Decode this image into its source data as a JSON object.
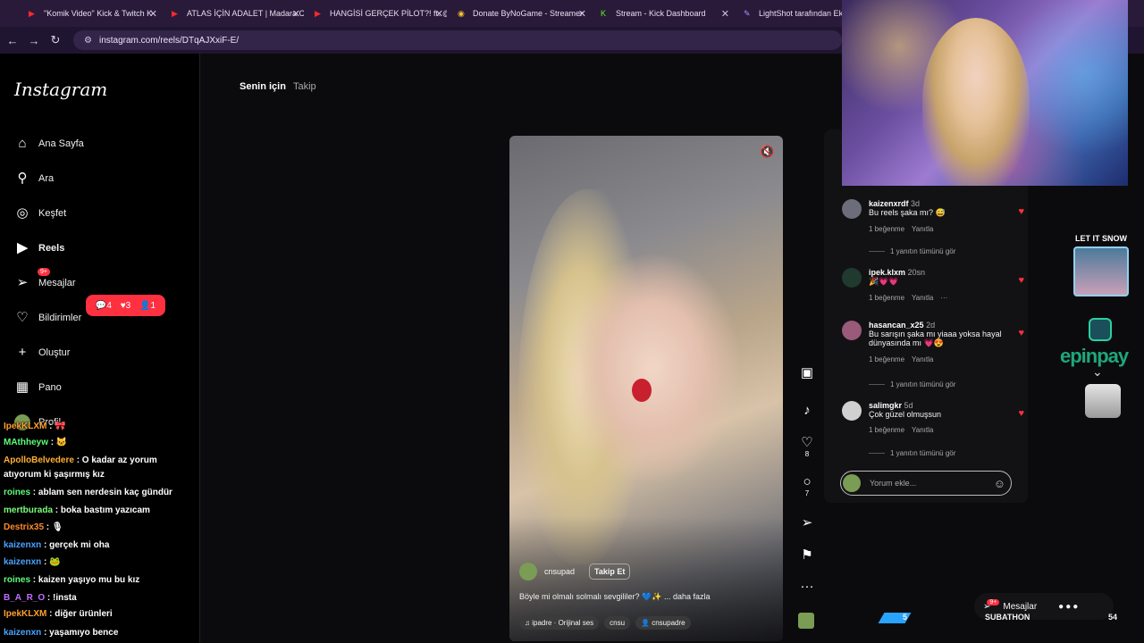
{
  "browser": {
    "tabs": [
      {
        "title": "\"Komik Video\" Kick & Twitch K",
        "color": "#ff2a2a",
        "glyph": "▶"
      },
      {
        "title": "ATLAS İÇİN ADALET | Madara C",
        "color": "#ff2a2a",
        "glyph": "▶"
      },
      {
        "title": "HANGİSİ GERÇEK PİLOT?! ft. @",
        "color": "#ff2a2a",
        "glyph": "▶"
      },
      {
        "title": "Donate ByNoGame - Streamer",
        "color": "#f2c230",
        "glyph": "◉"
      },
      {
        "title": "Stream - Kick Dashboard",
        "color": "#53fc18",
        "glyph": "K"
      },
      {
        "title": "LightShot tarafından Ekran Gö",
        "color": "#b38bff",
        "glyph": "✎"
      }
    ],
    "url": "instagram.com/reels/DTqAJXxiF-E/"
  },
  "sidebar": {
    "logo": "Instagram",
    "items": [
      {
        "label": "Ana Sayfa",
        "icon": "home-icon",
        "glyph": "⌂"
      },
      {
        "label": "Ara",
        "icon": "search-icon",
        "glyph": "⚲"
      },
      {
        "label": "Keşfet",
        "icon": "compass-icon",
        "glyph": "◎"
      },
      {
        "label": "Reels",
        "icon": "reels-icon",
        "glyph": "▶"
      },
      {
        "label": "Mesajlar",
        "icon": "messages-icon",
        "glyph": "➢"
      },
      {
        "label": "Bildirimler",
        "icon": "heart-icon",
        "glyph": "♡"
      },
      {
        "label": "Oluştur",
        "icon": "plus-icon",
        "glyph": "+"
      },
      {
        "label": "Pano",
        "icon": "dashboard-icon",
        "glyph": "▦"
      },
      {
        "label": "Profil",
        "icon": "profile-avatar-icon",
        "glyph": ""
      }
    ],
    "messages_badge": "9+",
    "notifications": {
      "comments": "4",
      "likes": "3",
      "follows": "1"
    }
  },
  "feed_tabs": {
    "active": "Senin için",
    "other": "Takip"
  },
  "reel": {
    "author": "cnsupad",
    "follow_label": "Takip Et",
    "caption": "Böyle mi olmalı solmalı sevgililer? 💙✨ ... daha fazla",
    "audio": "♫ ipadre · Orijinal ses",
    "tag1": "cnsu",
    "tag2": "👤 cnsupadre",
    "likes": "8",
    "comments": "7"
  },
  "comments": [
    {
      "user": "kaizenxrdf",
      "time": "3d",
      "text": "Bu reels şaka mı? 😅",
      "likes": "1 beğenme",
      "reply": "Yanıtla",
      "replies": "1 yanıtın tümünü gör",
      "avatar": "#6c6c7a"
    },
    {
      "user": "ipek.klxm",
      "time": "20sn",
      "text": "🎉💗💗",
      "likes": "1 beğenme",
      "reply": "Yanıtla",
      "more": "···",
      "replies": "",
      "avatar": "#203a30"
    },
    {
      "user": "hasancan_x25",
      "time": "2d",
      "text": "Bu sarışın şaka mı yiaaa yoksa hayal dünyasında mı 💗😍",
      "likes": "1 beğenme",
      "reply": "Yanıtla",
      "replies": "1 yanıtın tümünü gör",
      "avatar": "#9a5a7a"
    },
    {
      "user": "salimgkr",
      "time": "5d",
      "text": "Çok güzel olmuşsun",
      "likes": "1 beğenme",
      "reply": "Yanıtla",
      "replies": "1 yanıtın tümünü gör",
      "avatar": "#d0d0d0"
    }
  ],
  "comment_input": {
    "placeholder": "Yorum ekle..."
  },
  "overlays": {
    "snow_title": "LET IT SNOW",
    "epin": "epinpay"
  },
  "chat": [
    {
      "user": "IpekKLXM",
      "color": "#ff9f2f",
      "text": " : 🎀"
    },
    {
      "user": "MAthheyw",
      "color": "#5cff7a",
      "text": " : 🐱"
    },
    {
      "user": "ApolloBelvedere",
      "color": "#ffb030",
      "text": " : O kadar az yorum"
    },
    {
      "user": "",
      "color": "#fff",
      "text": "atıyorum ki şaşırmış kız"
    },
    {
      "user": "roines",
      "color": "#5cff7a",
      "text": " : ablam sen nerdesin kaç gündür"
    },
    {
      "user": "mertburada",
      "color": "#7aff7a",
      "text": " : boka bastım yazıcam"
    },
    {
      "user": "Destrix35",
      "color": "#ff8a2a",
      "text": " : 🎙"
    },
    {
      "user": "kaizenxn",
      "color": "#4aa3ff",
      "text": " : gerçek mi oha"
    },
    {
      "user": "kaizenxn",
      "color": "#4aa3ff",
      "text": " : 🐸"
    },
    {
      "user": "roines",
      "color": "#5cff7a",
      "text": " : kaizen yaşıyo mu bu kız"
    },
    {
      "user": "B_A_R_O",
      "color": "#c070ff",
      "text": " : !insta"
    },
    {
      "user": "IpekKLXM",
      "color": "#ff9f2f",
      "text": " : diğer ürünleri"
    },
    {
      "user": "kaizenxn",
      "color": "#4aa3ff",
      "text": " : yaşamıyo bence"
    }
  ],
  "bottom_bar": {
    "messages": "Mesajlar",
    "badge": "9+",
    "subathon": "SUBATHON",
    "left_num": "5",
    "right_num": "54"
  }
}
